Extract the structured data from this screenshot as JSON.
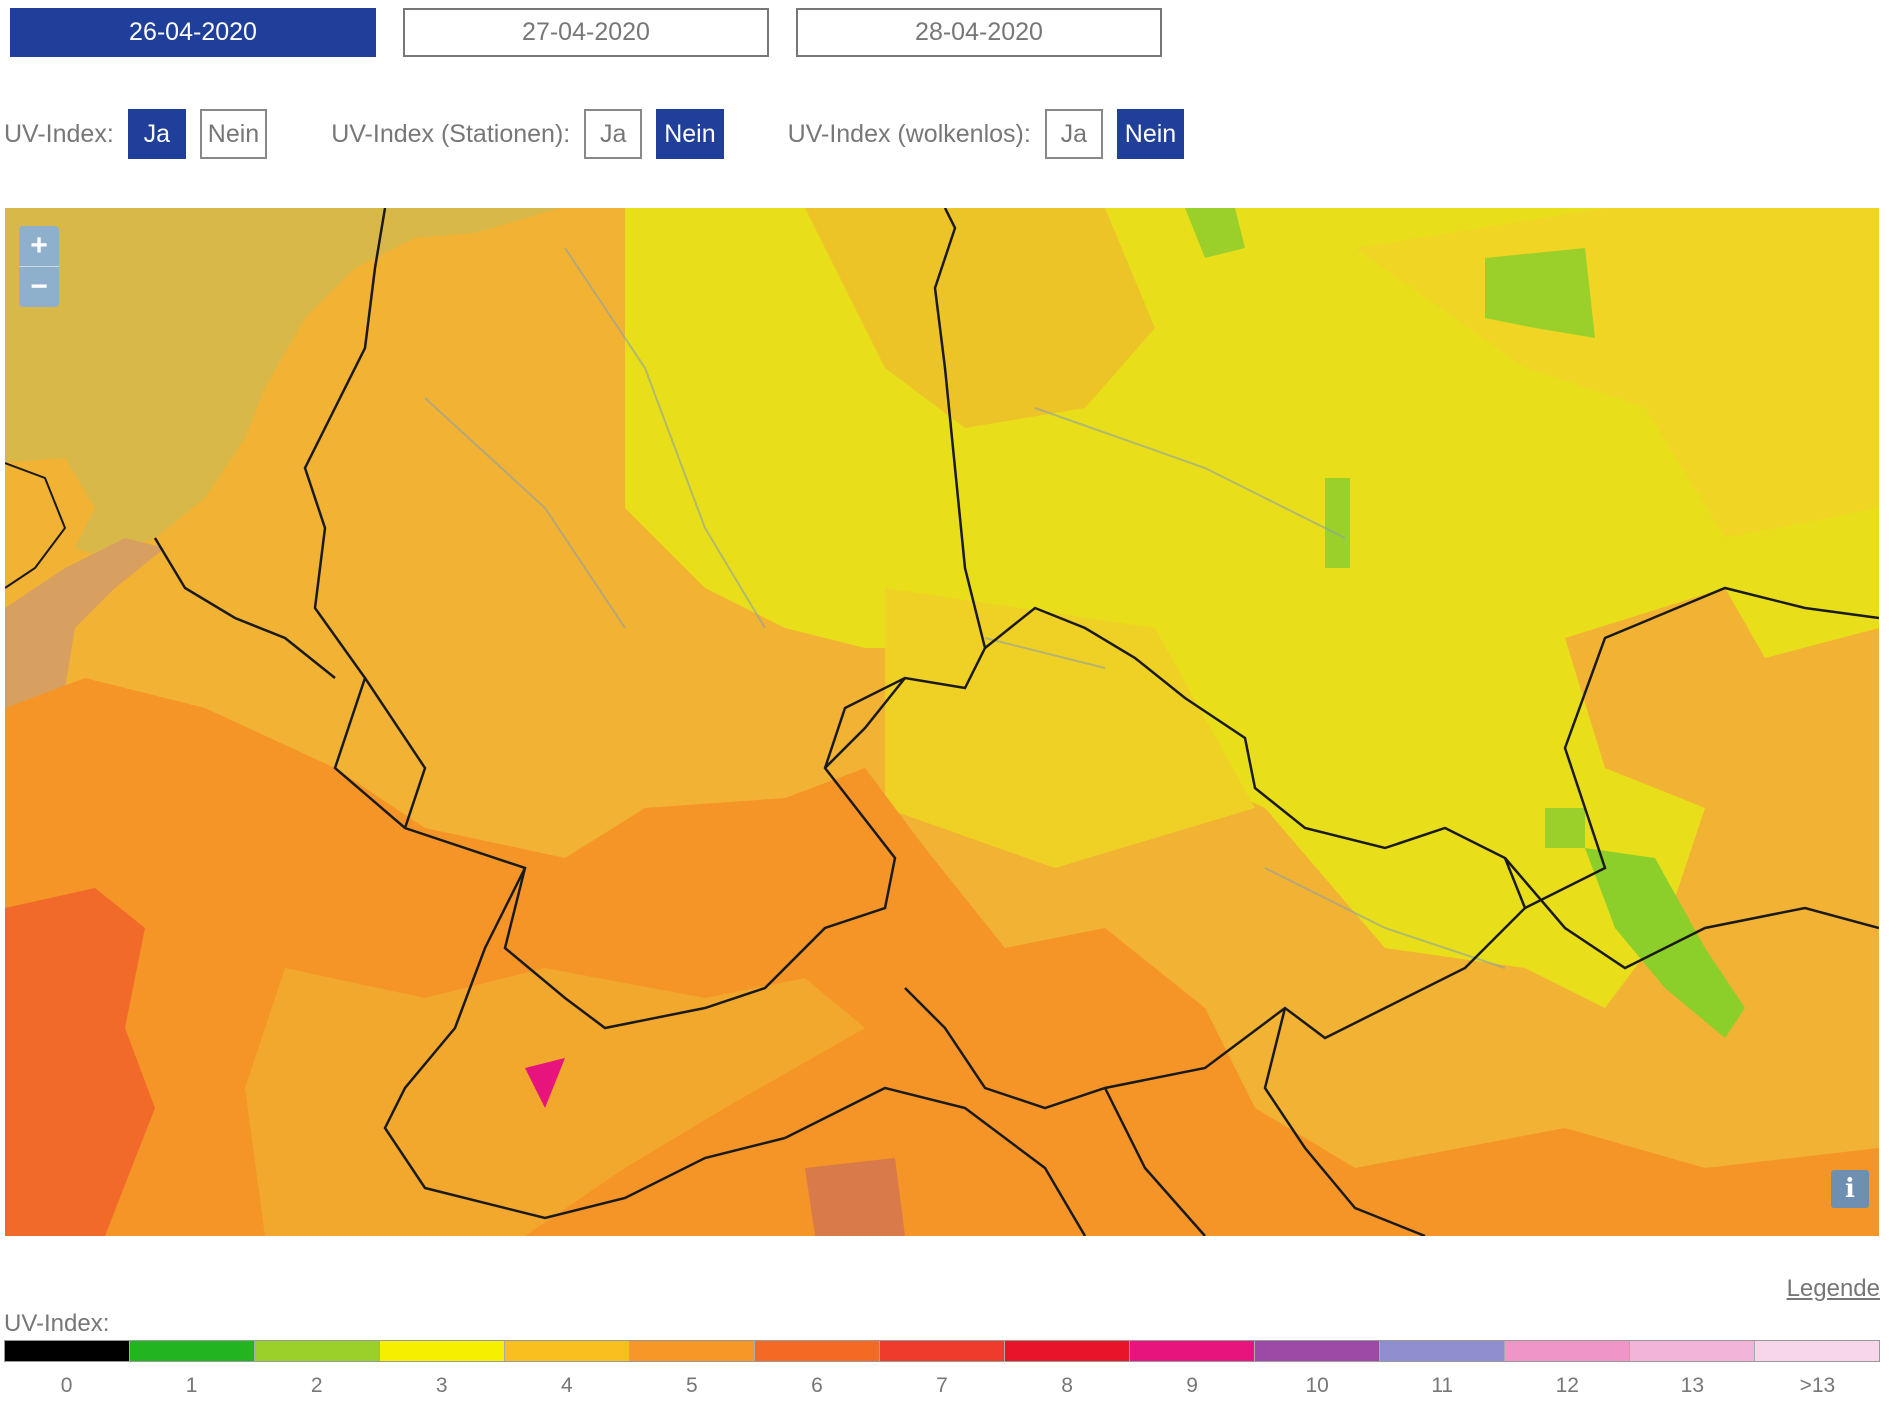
{
  "dates": [
    {
      "label": "26-04-2020",
      "active": true
    },
    {
      "label": "27-04-2020",
      "active": false
    },
    {
      "label": "28-04-2020",
      "active": false
    }
  ],
  "toggles": [
    {
      "label": "UV-Index:",
      "yes": "Ja",
      "no": "Nein",
      "selected": "yes"
    },
    {
      "label": "UV-Index (Stationen):",
      "yes": "Ja",
      "no": "Nein",
      "selected": "no"
    },
    {
      "label": "UV-Index (wolkenlos):",
      "yes": "Ja",
      "no": "Nein",
      "selected": "no"
    }
  ],
  "map": {
    "zoom_in": "+",
    "zoom_out": "−",
    "info": "i"
  },
  "legend": {
    "link": "Legende",
    "title": "UV-Index:",
    "classes": [
      {
        "label": "0",
        "color": "#000000"
      },
      {
        "label": "1",
        "color": "#22b51f"
      },
      {
        "label": "2",
        "color": "#9bd02a"
      },
      {
        "label": "3",
        "color": "#f4f000"
      },
      {
        "label": "4",
        "color": "#f8bf1f"
      },
      {
        "label": "5",
        "color": "#f79727"
      },
      {
        "label": "6",
        "color": "#f46a25"
      },
      {
        "label": "7",
        "color": "#ee3b2b"
      },
      {
        "label": "8",
        "color": "#e8152a"
      },
      {
        "label": "9",
        "color": "#e7147d"
      },
      {
        "label": "10",
        "color": "#9c4aa6"
      },
      {
        "label": "11",
        "color": "#8f8fd0"
      },
      {
        "label": "12",
        "color": "#f095c8"
      },
      {
        "label": "13",
        "color": "#f3b4da"
      },
      {
        "label": ">13",
        "color": "#f8d6ea"
      }
    ]
  }
}
